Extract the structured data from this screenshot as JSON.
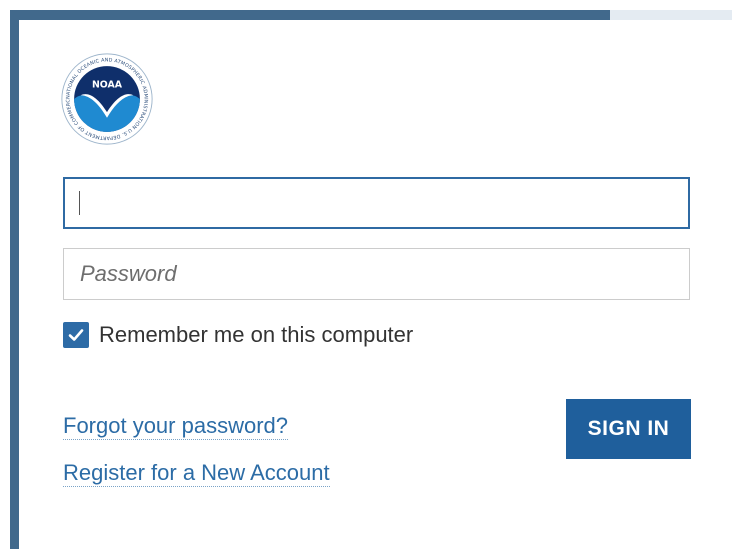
{
  "logo": {
    "text": "NOAA",
    "ring_text": "NATIONAL OCEANIC AND ATMOSPHERIC ADMINISTRATION U.S. DEPARTMENT OF COMMERCE",
    "icon": "noaa-logo-icon"
  },
  "form": {
    "username": {
      "value": "",
      "placeholder": ""
    },
    "password": {
      "value": "",
      "placeholder": "Password"
    },
    "remember": {
      "label": "Remember me on this computer",
      "checked": true
    },
    "forgot_link": "Forgot your password?",
    "register_link": "Register for a New Account",
    "signin_label": "SIGN IN"
  },
  "colors": {
    "accent": "#1f5f9c",
    "frame": "#41698c",
    "link": "#2c6ca6"
  }
}
